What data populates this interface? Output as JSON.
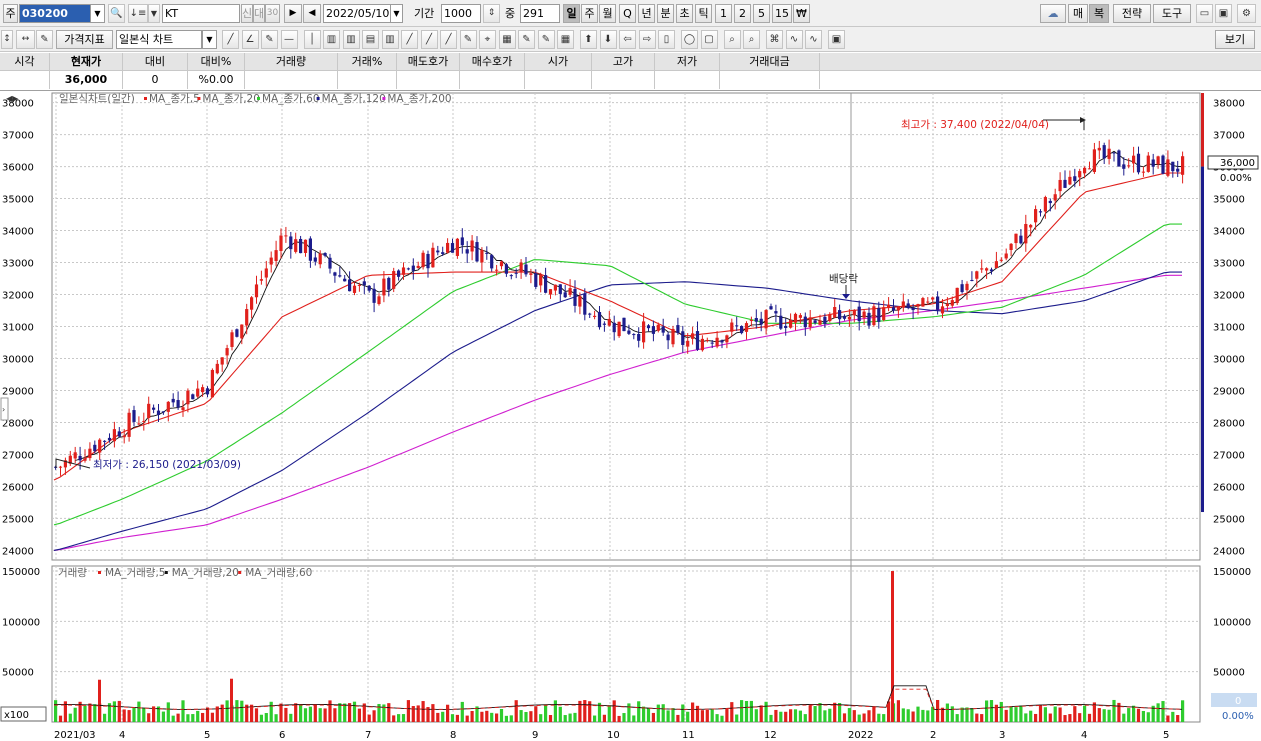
{
  "toolbar1": {
    "market_tab": "주",
    "code": "030200",
    "name": "KT",
    "name_tabs": [
      "신",
      "대",
      "30"
    ],
    "date": "2022/05/10",
    "period_label": "기간",
    "period_value": "1000",
    "middle_label": "중",
    "middle_value": "291",
    "intervals": [
      "일",
      "주",
      "월",
      "Q",
      "년",
      "분",
      "초",
      "틱",
      "1",
      "2",
      "5",
      "15",
      "₩"
    ],
    "active_interval": "일",
    "right_buttons": [
      "매",
      "복",
      "전략",
      "도구"
    ]
  },
  "toolbar2": {
    "indicator_button": "가격지표",
    "chart_type": "일본식 차트",
    "view_button": "보기"
  },
  "quote": {
    "headers": [
      "시각",
      "현재가",
      "대비",
      "대비%",
      "거래량",
      "거래%",
      "매도호가",
      "매수호가",
      "시가",
      "고가",
      "저가",
      "거래대금"
    ],
    "values": [
      "",
      "36,000",
      "0",
      "%0.00",
      "",
      "",
      "",
      "",
      "",
      "",
      "",
      ""
    ]
  },
  "price_chart": {
    "legend_title": "일본식차트(일간)",
    "legend_items": [
      {
        "name": "MA_종가,5",
        "color": "#e0201c"
      },
      {
        "name": "MA_종가,20",
        "color": "#e0201c"
      },
      {
        "name": "MA_종가,60",
        "color": "#2ecc2e"
      },
      {
        "name": "MA_종가,120",
        "color": "#1c1c8c"
      },
      {
        "name": "MA_종가,200",
        "color": "#d020d0"
      }
    ],
    "high_annotation": "최고가 : 37,400 (2022/04/04)",
    "low_annotation": "최저가 : 26,150 (2021/03/09)",
    "event_annotation": "배당락",
    "current_price_label": "36,000",
    "current_change_label": "0.00%"
  },
  "volume_chart": {
    "legend_title": "거래량",
    "legend_items": [
      {
        "name": "MA_거래량,5",
        "color": "#e0201c"
      },
      {
        "name": "MA_거래량,20",
        "color": "#111111"
      },
      {
        "name": "MA_거래량,60",
        "color": "#e0201c"
      }
    ],
    "unit_label": "x100",
    "current_volume_label": "0",
    "current_volume_pct": "0.00%"
  },
  "chart_data": [
    {
      "type": "candlestick",
      "title": "일본식차트(일간)",
      "ylim": [
        23700,
        38300
      ],
      "y_ticks": [
        24000,
        25000,
        26000,
        27000,
        28000,
        29000,
        30000,
        31000,
        32000,
        33000,
        34000,
        35000,
        36000,
        37000,
        38000
      ],
      "x_ticks": [
        "2021/03",
        "4",
        "5",
        "6",
        "7",
        "8",
        "9",
        "10",
        "11",
        "12",
        "2022",
        "2",
        "3",
        "4",
        "5"
      ],
      "dates": [
        "2021/03",
        "2021/04",
        "2021/05",
        "2021/06",
        "2021/07",
        "2021/08",
        "2021/09",
        "2021/10",
        "2021/11",
        "2021/12",
        "2022/01",
        "2022/02",
        "2022/03",
        "2022/04",
        "2022/05/10"
      ],
      "close": [
        26600,
        27900,
        29200,
        33900,
        31900,
        33700,
        32500,
        31100,
        30500,
        31200,
        31300,
        31600,
        33200,
        36300,
        36000
      ],
      "ma20": [
        26200,
        27700,
        28600,
        31300,
        32600,
        32700,
        32700,
        31800,
        30700,
        31000,
        31500,
        31700,
        32400,
        35200,
        35800
      ],
      "ma60": [
        24800,
        25600,
        26800,
        28300,
        30200,
        32100,
        33100,
        32900,
        31700,
        31100,
        31100,
        31300,
        31600,
        32600,
        34200
      ],
      "ma120": [
        24000,
        24600,
        25300,
        26500,
        28300,
        30200,
        31500,
        32300,
        32400,
        32200,
        31800,
        31500,
        31400,
        31800,
        32700
      ],
      "ma200": [
        24000,
        24400,
        24800,
        25600,
        26600,
        27700,
        28700,
        29500,
        30200,
        30700,
        31200,
        31500,
        31800,
        32200,
        32600
      ],
      "high": {
        "value": 37400,
        "date": "2022/04/04"
      },
      "low": {
        "value": 26150,
        "date": "2021/03/09"
      },
      "last": 36000
    },
    {
      "type": "bar",
      "title": "거래량",
      "unit": "x100",
      "ylim": [
        0,
        155000
      ],
      "y_ticks": [
        50000,
        100000,
        150000
      ],
      "spikes": [
        {
          "date": "2021/03",
          "value": 42000
        },
        {
          "date": "2021/05",
          "value": 43000
        },
        {
          "date": "2022/01",
          "value": 150000
        }
      ],
      "typical_range": [
        6000,
        22000
      ],
      "last": 0
    }
  ]
}
